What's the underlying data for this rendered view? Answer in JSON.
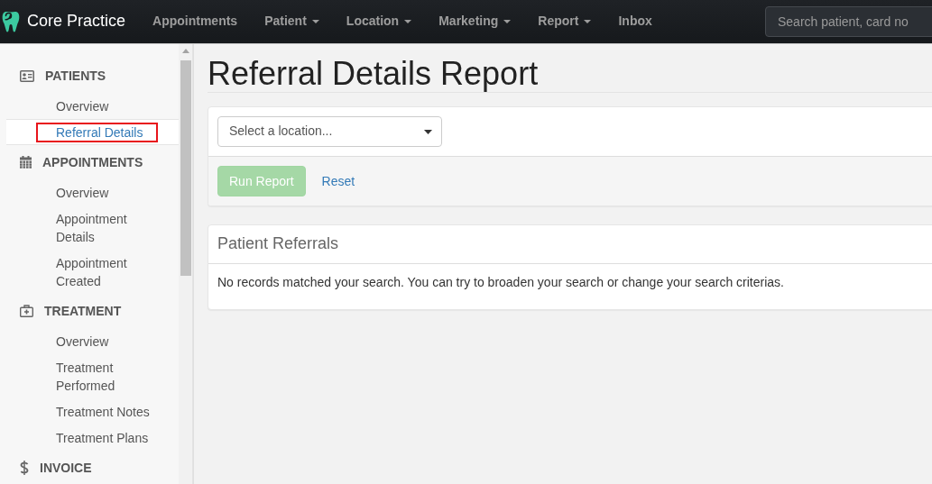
{
  "navbar": {
    "brand": "Core Practice",
    "menu": [
      {
        "label": "Appointments",
        "dropdown": false
      },
      {
        "label": "Patient",
        "dropdown": true
      },
      {
        "label": "Location",
        "dropdown": true
      },
      {
        "label": "Marketing",
        "dropdown": true
      },
      {
        "label": "Report",
        "dropdown": true
      },
      {
        "label": "Inbox",
        "dropdown": false
      }
    ],
    "search": {
      "placeholder": "Search patient, card no"
    }
  },
  "sidebar": {
    "sections": [
      {
        "title": "PATIENTS",
        "items": [
          {
            "label": "Overview",
            "selected": false,
            "outlined": false
          },
          {
            "label": "Referral Details",
            "selected": true,
            "outlined": true
          }
        ]
      },
      {
        "title": "APPOINTMENTS",
        "items": [
          {
            "label": "Overview",
            "selected": false,
            "outlined": false
          },
          {
            "label": "Appointment Details",
            "selected": false,
            "outlined": false
          },
          {
            "label": "Appointment Created",
            "selected": false,
            "outlined": false
          }
        ]
      },
      {
        "title": "TREATMENT",
        "items": [
          {
            "label": "Overview",
            "selected": false,
            "outlined": false
          },
          {
            "label": "Treatment Performed",
            "selected": false,
            "outlined": false
          },
          {
            "label": "Treatment Notes",
            "selected": false,
            "outlined": false
          },
          {
            "label": "Treatment Plans",
            "selected": false,
            "outlined": false
          }
        ]
      },
      {
        "title": "INVOICE"
      }
    ]
  },
  "page": {
    "title": "Referral Details Report"
  },
  "filter_panel": {
    "location_select": {
      "placeholder": "Select a location..."
    },
    "run_button": {
      "label": "Run Report",
      "disabled": true
    },
    "reset_link": {
      "label": "Reset"
    }
  },
  "results_panel": {
    "title": "Patient Referrals",
    "message": "No records matched your search. You can try to broaden your search or change your search criterias."
  }
}
